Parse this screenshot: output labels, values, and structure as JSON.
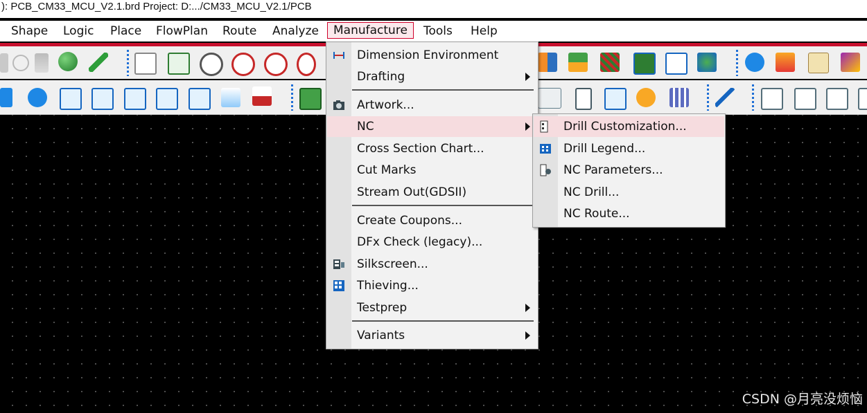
{
  "window": {
    "title": "): PCB_CM33_MCU_V2.1.brd  Project: D:.../CM33_MCU_V2.1/PCB"
  },
  "menubar": {
    "items": [
      {
        "label": "Shape"
      },
      {
        "label": "Logic"
      },
      {
        "label": "Place"
      },
      {
        "label": "FlowPlan"
      },
      {
        "label": "Route"
      },
      {
        "label": "Analyze"
      },
      {
        "label": "Manufacture"
      },
      {
        "label": "Tools"
      },
      {
        "label": "Help"
      }
    ]
  },
  "manufacture_menu": {
    "items": [
      {
        "label": "Dimension Environment",
        "icon": "dimension-icon"
      },
      {
        "label": "Drafting",
        "submenu": true
      },
      {
        "label": "Artwork...",
        "icon": "camera-icon"
      },
      {
        "label": "NC",
        "submenu": true
      },
      {
        "label": "Cross Section Chart..."
      },
      {
        "label": "Cut Marks"
      },
      {
        "label": "Stream Out(GDSII)"
      },
      {
        "label": "Create Coupons..."
      },
      {
        "label": "DFx Check (legacy)..."
      },
      {
        "label": "Silkscreen...",
        "icon": "silkscreen-icon"
      },
      {
        "label": "Thieving...",
        "icon": "thieving-icon"
      },
      {
        "label": "Testprep",
        "submenu": true
      },
      {
        "label": "Variants",
        "submenu": true
      }
    ]
  },
  "nc_submenu": {
    "items": [
      {
        "label": "Drill Customization...",
        "icon": "drill-customization-icon"
      },
      {
        "label": "Drill Legend...",
        "icon": "drill-legend-icon"
      },
      {
        "label": "NC Parameters...",
        "icon": "nc-parameters-icon"
      },
      {
        "label": "NC Drill..."
      },
      {
        "label": "NC Route..."
      }
    ]
  },
  "watermark": "CSDN @月亮没烦恼",
  "colors": {
    "accent": "#c8102e",
    "highlight": "#f6dcdf",
    "canvas": "#000000"
  }
}
